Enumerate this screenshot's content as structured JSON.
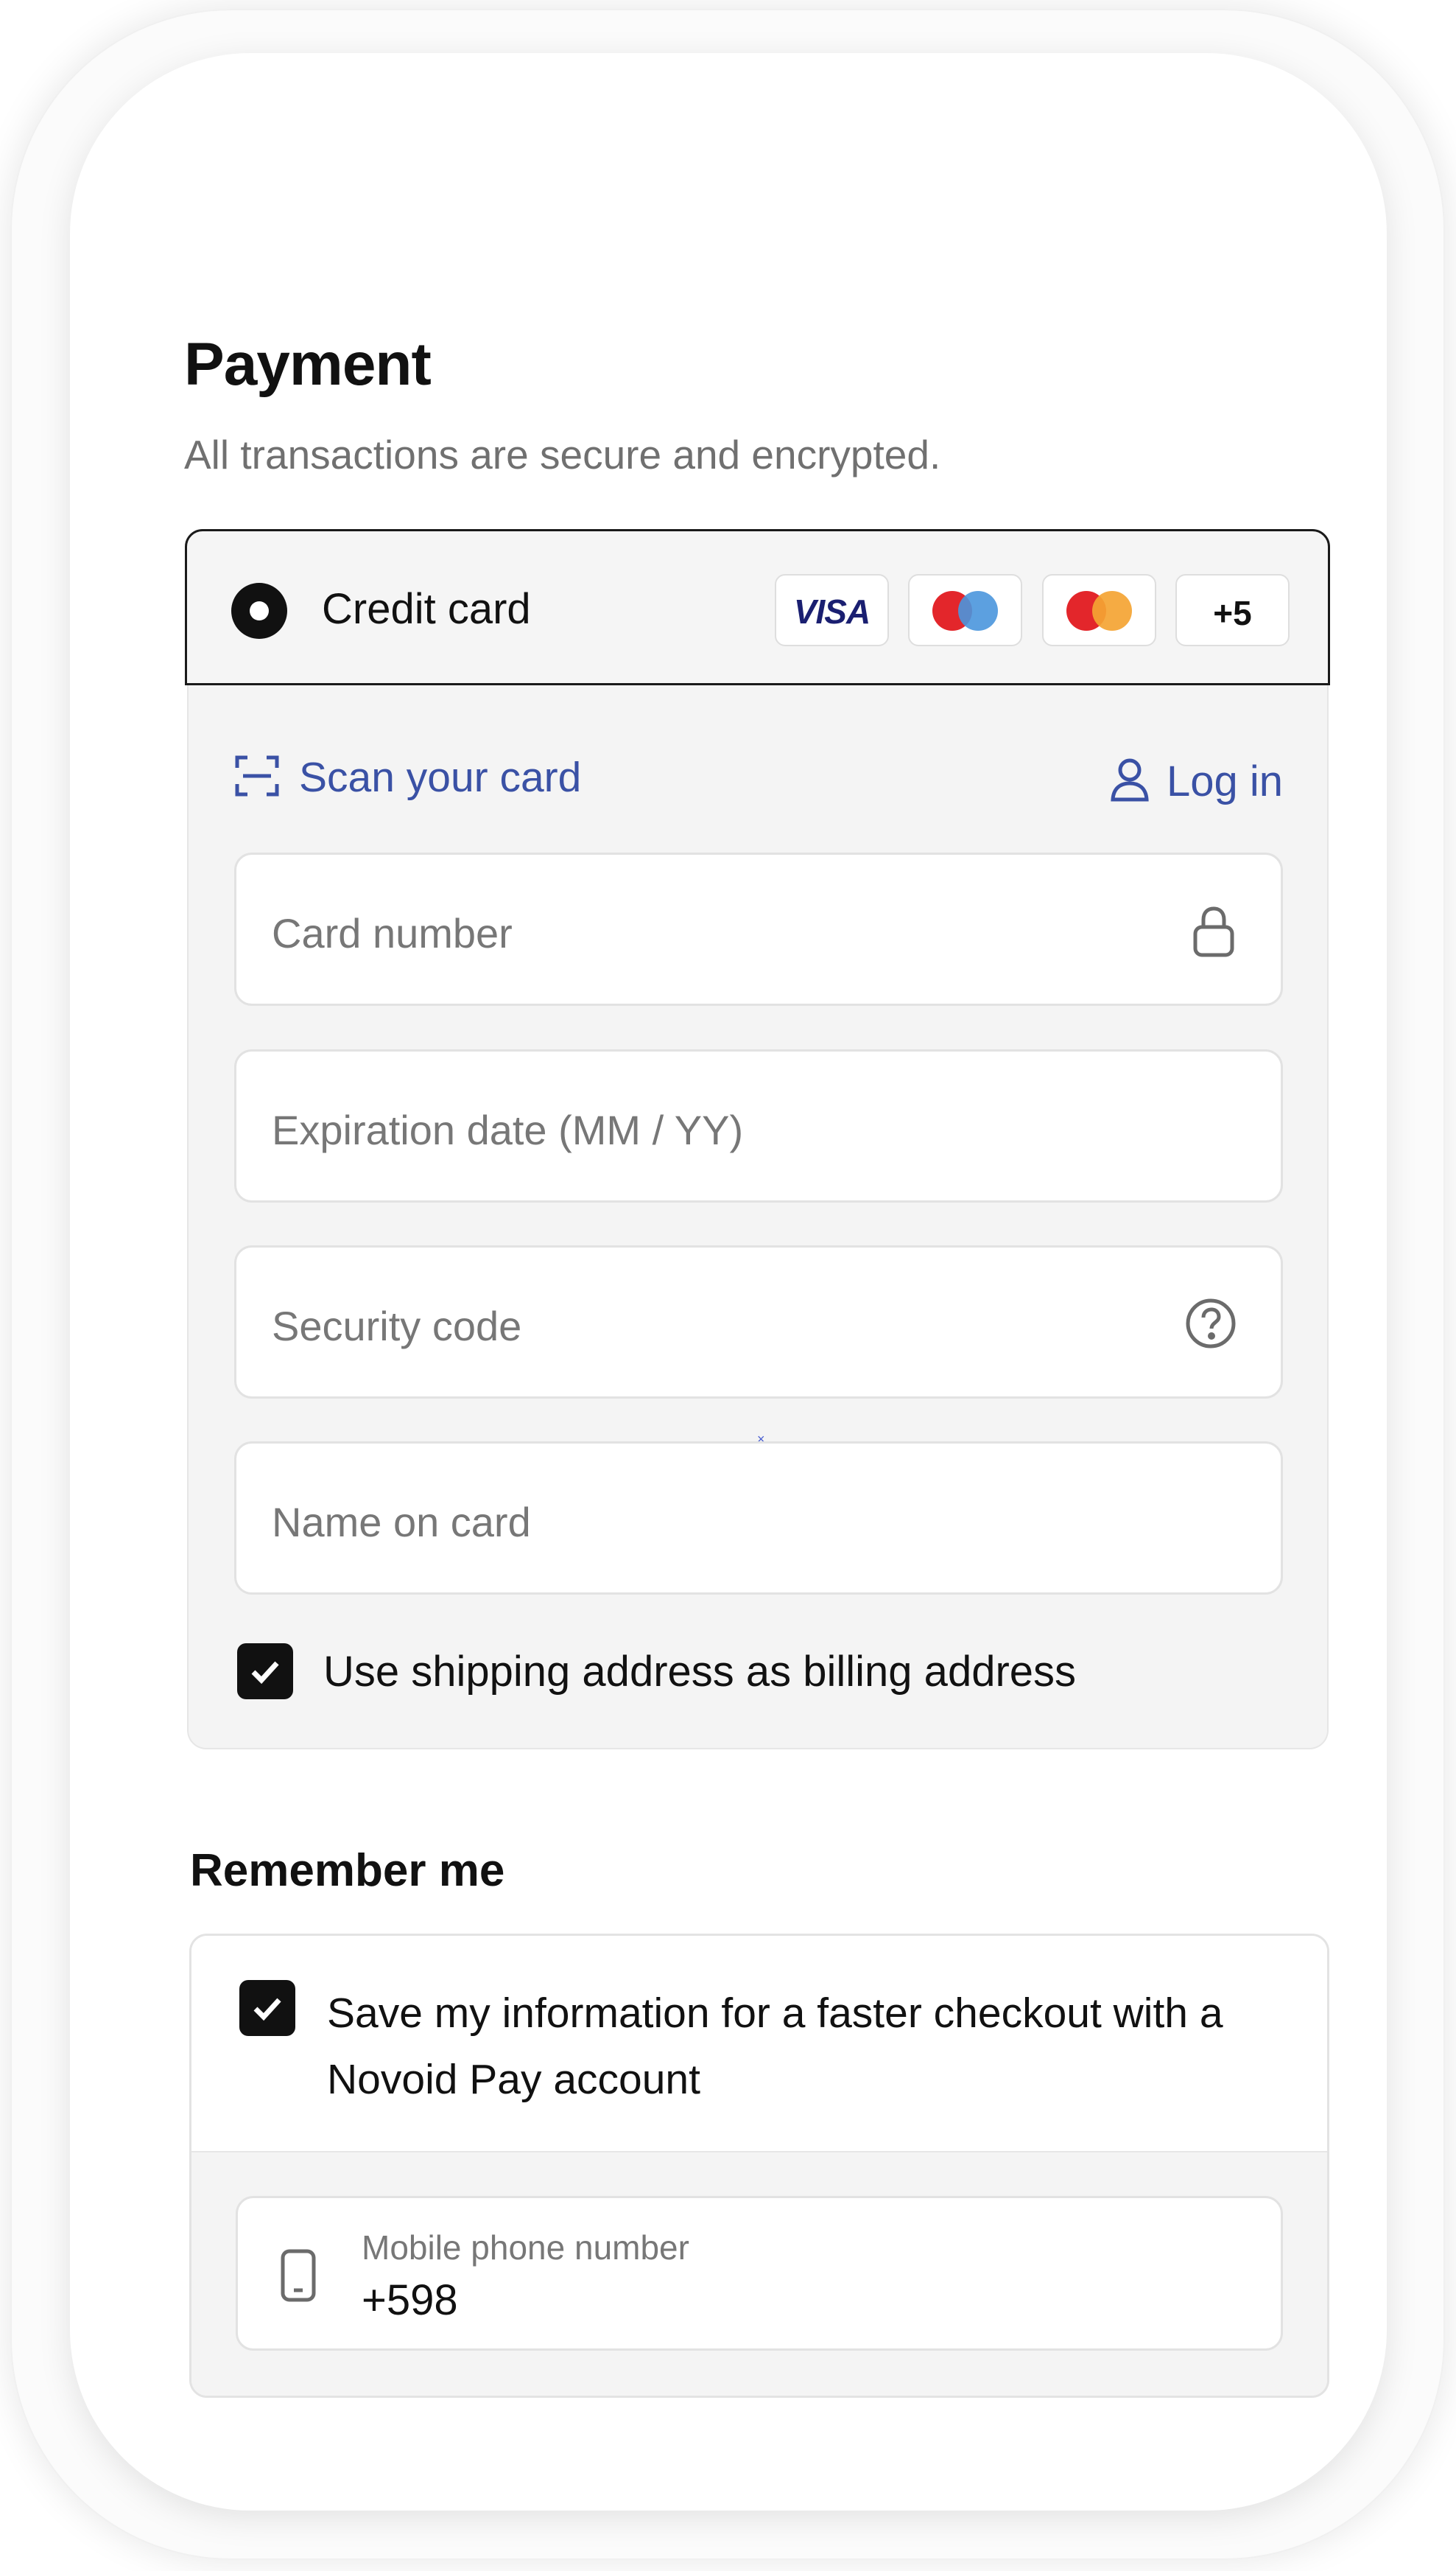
{
  "page": {
    "title": "Payment",
    "subtitle": "All transactions are secure and encrypted."
  },
  "payment_method": {
    "label": "Credit card",
    "selected": true,
    "brands": [
      {
        "name": "VISA",
        "icon": "visa-logo"
      },
      {
        "name": "Maestro",
        "icon": "maestro-logo"
      },
      {
        "name": "Mastercard",
        "icon": "mastercard-logo"
      },
      {
        "name": "+5",
        "icon": "more-brands"
      }
    ]
  },
  "card_form": {
    "scan_label": "Scan your card",
    "login_label": "Log in",
    "fields": {
      "card_number": {
        "placeholder": "Card number",
        "icon": "lock-icon"
      },
      "expiration": {
        "placeholder": "Expiration date (MM / YY)"
      },
      "security_code": {
        "placeholder": "Security code",
        "icon": "help-circle-icon"
      },
      "name_on_card": {
        "placeholder": "Name on card"
      }
    },
    "billing_checkbox": {
      "label": "Use shipping address as billing address",
      "checked": true
    }
  },
  "remember": {
    "title": "Remember me",
    "save_checkbox": {
      "label": "Save my information for a faster checkout with a Novoid Pay account",
      "checked": true
    },
    "phone": {
      "label": "Mobile phone number",
      "value": "+598",
      "icon": "mobile-phone-icon"
    }
  },
  "colors": {
    "link": "#3a51a5",
    "text": "#111111",
    "muted": "#777777",
    "panel": "#f4f4f4",
    "border": "#e2e2e2"
  }
}
